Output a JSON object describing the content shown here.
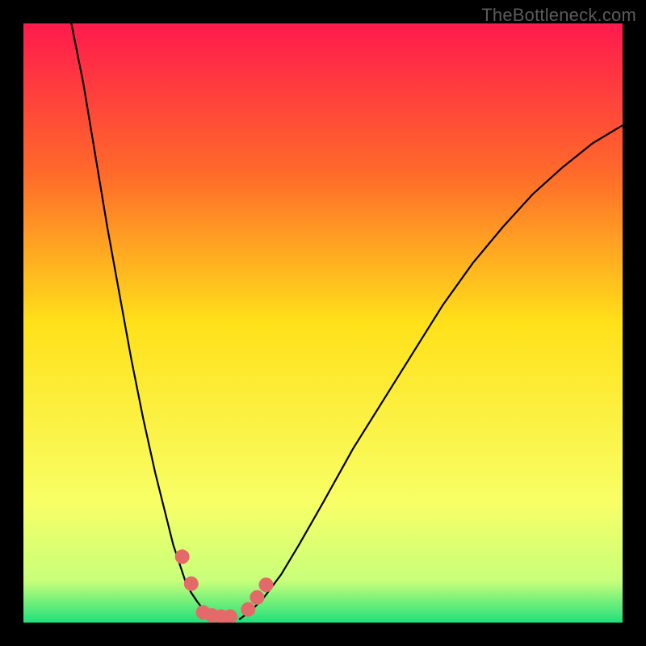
{
  "watermark": {
    "text": "TheBottleneck.com"
  },
  "chart_data": {
    "type": "line",
    "title": "",
    "xlabel": "",
    "ylabel": "",
    "xlim": [
      0,
      100
    ],
    "ylim": [
      0,
      100
    ],
    "grid": false,
    "gradient_stops": [
      {
        "offset": 0,
        "color": "#ff1a4d"
      },
      {
        "offset": 25,
        "color": "#ff6a2a"
      },
      {
        "offset": 50,
        "color": "#ffe11a"
      },
      {
        "offset": 80,
        "color": "#f8ff66"
      },
      {
        "offset": 93,
        "color": "#c8ff7a"
      },
      {
        "offset": 100,
        "color": "#1fe07a"
      }
    ],
    "series": [
      {
        "name": "curve-left",
        "x": [
          8,
          10,
          12,
          14,
          16,
          18,
          20,
          22,
          24,
          25,
          26,
          27,
          28,
          29,
          30,
          31,
          32
        ],
        "y": [
          100,
          90,
          78,
          66,
          55,
          44,
          34,
          25,
          17,
          13,
          10,
          7,
          5,
          3.5,
          2.2,
          1.2,
          0.5
        ]
      },
      {
        "name": "curve-right",
        "x": [
          36,
          38,
          40,
          43,
          46,
          50,
          55,
          60,
          65,
          70,
          75,
          80,
          85,
          90,
          95,
          100
        ],
        "y": [
          0.5,
          2,
          4,
          8,
          13,
          20,
          29,
          37,
          45,
          53,
          60,
          66,
          71.5,
          76,
          80,
          83
        ]
      }
    ],
    "markers": {
      "name": "highlight-points",
      "color": "#e46a6a",
      "r": 9,
      "points": [
        {
          "x": 26.5,
          "y": 11
        },
        {
          "x": 28,
          "y": 6.5
        },
        {
          "x": 30,
          "y": 1.7
        },
        {
          "x": 31.5,
          "y": 1.2
        },
        {
          "x": 33,
          "y": 1.0
        },
        {
          "x": 34.5,
          "y": 1.0
        },
        {
          "x": 37.5,
          "y": 2.2
        },
        {
          "x": 39,
          "y": 4.2
        },
        {
          "x": 40.5,
          "y": 6.3
        }
      ]
    }
  }
}
